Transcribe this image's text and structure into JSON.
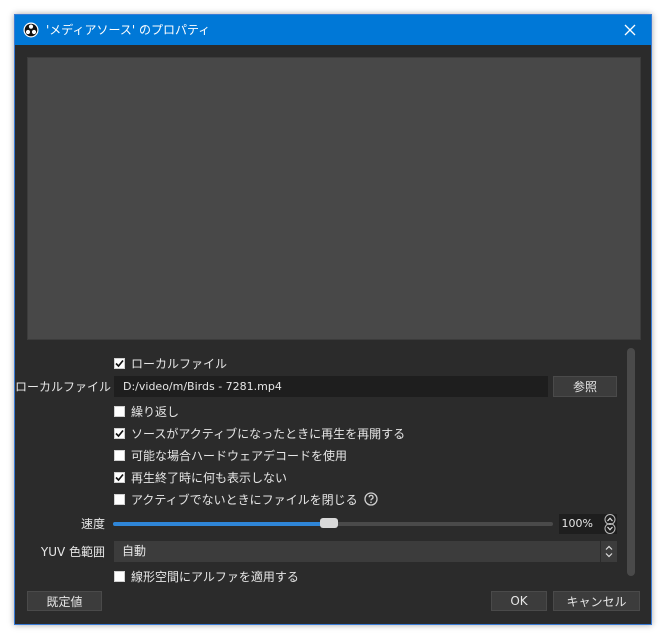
{
  "window": {
    "title": "'メディアソース' のプロパティ",
    "close_glyph": "✕",
    "icon": "obs-logo-icon",
    "accent": "#0078d7"
  },
  "form": {
    "local_file_checkbox": {
      "label": "ローカルファイル",
      "checked": true
    },
    "local_file_label": "ローカルファイル",
    "path_value": "D:/video/m/Birds - 7281.mp4",
    "browse_label": "参照",
    "checkboxes": [
      {
        "label": "繰り返し",
        "checked": false
      },
      {
        "label": "ソースがアクティブになったときに再生を再開する",
        "checked": true
      },
      {
        "label": "可能な場合ハードウェアデコードを使用",
        "checked": false
      },
      {
        "label": "再生終了時に何も表示しない",
        "checked": true
      },
      {
        "label": "アクティブでないときにファイルを閉じる",
        "checked": false
      }
    ],
    "speed_label": "速度",
    "speed_value": "100%",
    "speed_fraction": 0.49,
    "yuv_label": "YUV 色範囲",
    "yuv_value": "自動",
    "linear_alpha": {
      "label": "線形空間にアルファを適用する",
      "checked": false
    }
  },
  "buttons": {
    "defaults": "既定値",
    "ok": "OK",
    "cancel": "キャンセル"
  },
  "colors": {
    "slider_fill": "#2f86d8",
    "background": "#2b2b2b",
    "preview": "#484848"
  }
}
